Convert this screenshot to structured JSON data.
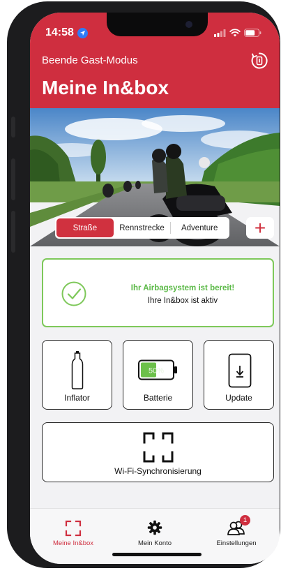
{
  "status_bar": {
    "time": "14:58",
    "location_icon": "location-arrow-icon",
    "signal_icon": "cellular-signal-icon",
    "wifi_icon": "wifi-icon",
    "battery_icon": "battery-icon"
  },
  "header": {
    "guest_mode_label": "Beende Gast-Modus",
    "title": "Meine In&box",
    "sync_icon": "sync-icon"
  },
  "riding_modes": {
    "options": [
      "Straße",
      "Rennstrecke",
      "Adventure"
    ],
    "selected": "Straße",
    "add_label": "+"
  },
  "airbag_status": {
    "ready_text": "Ihr Airbagsystem ist bereit!",
    "active_text": "Ihre In&box ist aktiv",
    "icon": "check-circle-icon",
    "color": "#7ec85a"
  },
  "tiles": {
    "inflator": {
      "label": "Inflator",
      "icon": "inflator-cylinder-icon"
    },
    "battery": {
      "label": "Batterie",
      "level_text": "50%",
      "level": 0.5,
      "icon": "battery-level-icon",
      "fill_color": "#6cc04a"
    },
    "update": {
      "label": "Update",
      "icon": "phone-download-icon"
    }
  },
  "wifi_sync": {
    "label": "Wi-Fi-Synchronisierung",
    "icon": "scan-frame-icon"
  },
  "tab_bar": {
    "items": [
      {
        "label": "Meine In&box",
        "icon": "scan-frame-icon",
        "active": true
      },
      {
        "label": "Mein Konto",
        "icon": "gear-icon",
        "active": false
      },
      {
        "label": "Einstellungen",
        "icon": "users-icon",
        "active": false,
        "badge": "1"
      }
    ]
  },
  "colors": {
    "brand_red": "#cf2e3f",
    "success_green": "#7ec85a"
  }
}
